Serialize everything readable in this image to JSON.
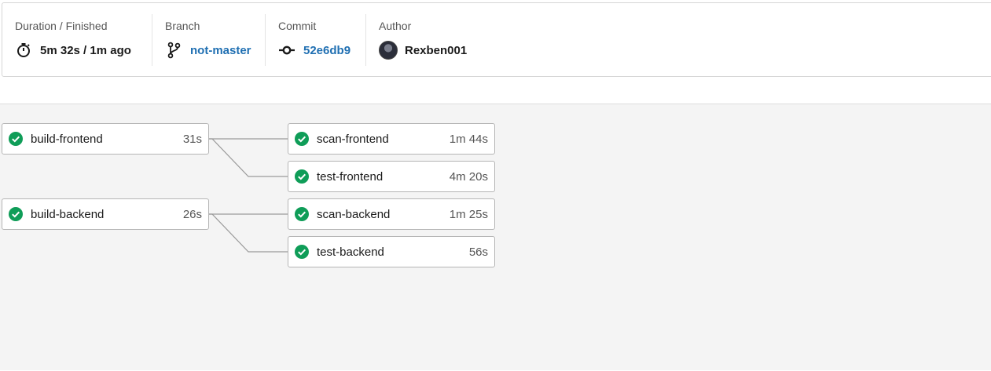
{
  "summary": {
    "duration": {
      "label": "Duration / Finished",
      "value": "5m 32s / 1m ago",
      "icon": "stopwatch-icon"
    },
    "branch": {
      "label": "Branch",
      "value": "not-master",
      "icon": "git-branch-icon"
    },
    "commit": {
      "label": "Commit",
      "value": "52e6db9",
      "icon": "git-commit-icon"
    },
    "author": {
      "label": "Author",
      "value": "Rexben001",
      "icon": "avatar"
    }
  },
  "colors": {
    "link": "#1f6fb2",
    "success": "#0f9d58"
  },
  "jobs": [
    {
      "name": "build-frontend",
      "duration": "31s",
      "status": "success"
    },
    {
      "name": "scan-frontend",
      "duration": "1m 44s",
      "status": "success"
    },
    {
      "name": "test-frontend",
      "duration": "4m 20s",
      "status": "success"
    },
    {
      "name": "build-backend",
      "duration": "26s",
      "status": "success"
    },
    {
      "name": "scan-backend",
      "duration": "1m 25s",
      "status": "success"
    },
    {
      "name": "test-backend",
      "duration": "56s",
      "status": "success"
    }
  ]
}
